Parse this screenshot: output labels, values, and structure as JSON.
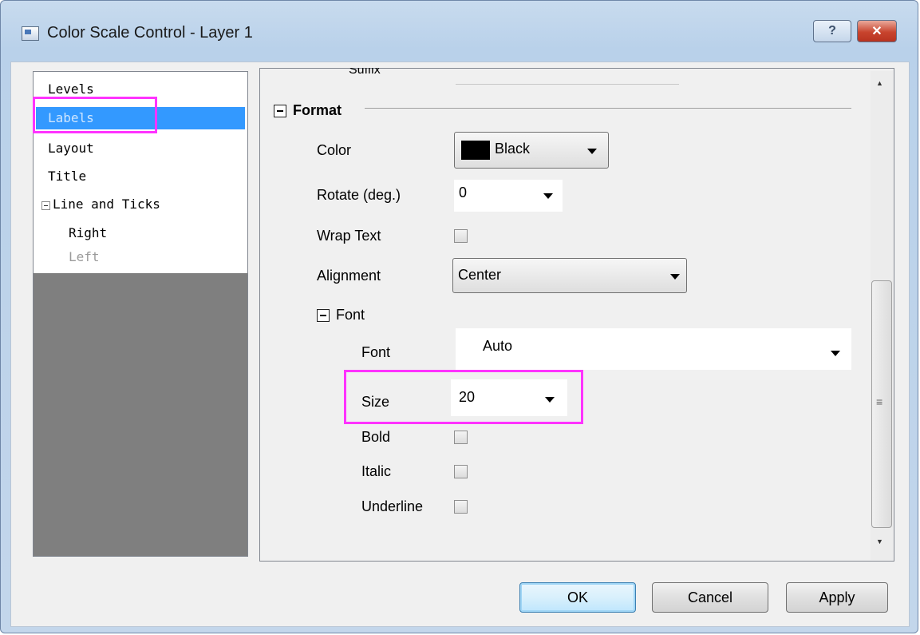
{
  "window": {
    "title": "Color Scale Control - Layer 1",
    "help_glyph": "?",
    "close_glyph": "✕"
  },
  "tree": {
    "items": [
      {
        "label": "Levels"
      },
      {
        "label": "Labels"
      },
      {
        "label": "Layout"
      },
      {
        "label": "Title"
      },
      {
        "label": "Line and Ticks"
      },
      {
        "label": "Right"
      },
      {
        "label": "Left"
      }
    ]
  },
  "properties": {
    "suffix_label": "Suffix",
    "format_section": "Format",
    "color": {
      "label": "Color",
      "value": "Black",
      "swatch": "#000000"
    },
    "rotate": {
      "label": "Rotate (deg.)",
      "value": "0"
    },
    "wrap_text": {
      "label": "Wrap Text",
      "checked": false
    },
    "alignment": {
      "label": "Alignment",
      "value": "Center"
    },
    "font_section": "Font",
    "font": {
      "label": "Font",
      "value": "Auto"
    },
    "size": {
      "label": "Size",
      "value": "20"
    },
    "bold": {
      "label": "Bold",
      "checked": false
    },
    "italic": {
      "label": "Italic",
      "checked": false
    },
    "underline": {
      "label": "Underline",
      "checked": false
    }
  },
  "scrollbar": {
    "up_glyph": "▲",
    "down_glyph": "▼",
    "grip_glyph": "≡"
  },
  "buttons": {
    "ok": "OK",
    "cancel": "Cancel",
    "apply": "Apply"
  },
  "colors": {
    "highlight": "#ff33ff",
    "selection": "#3399ff"
  }
}
